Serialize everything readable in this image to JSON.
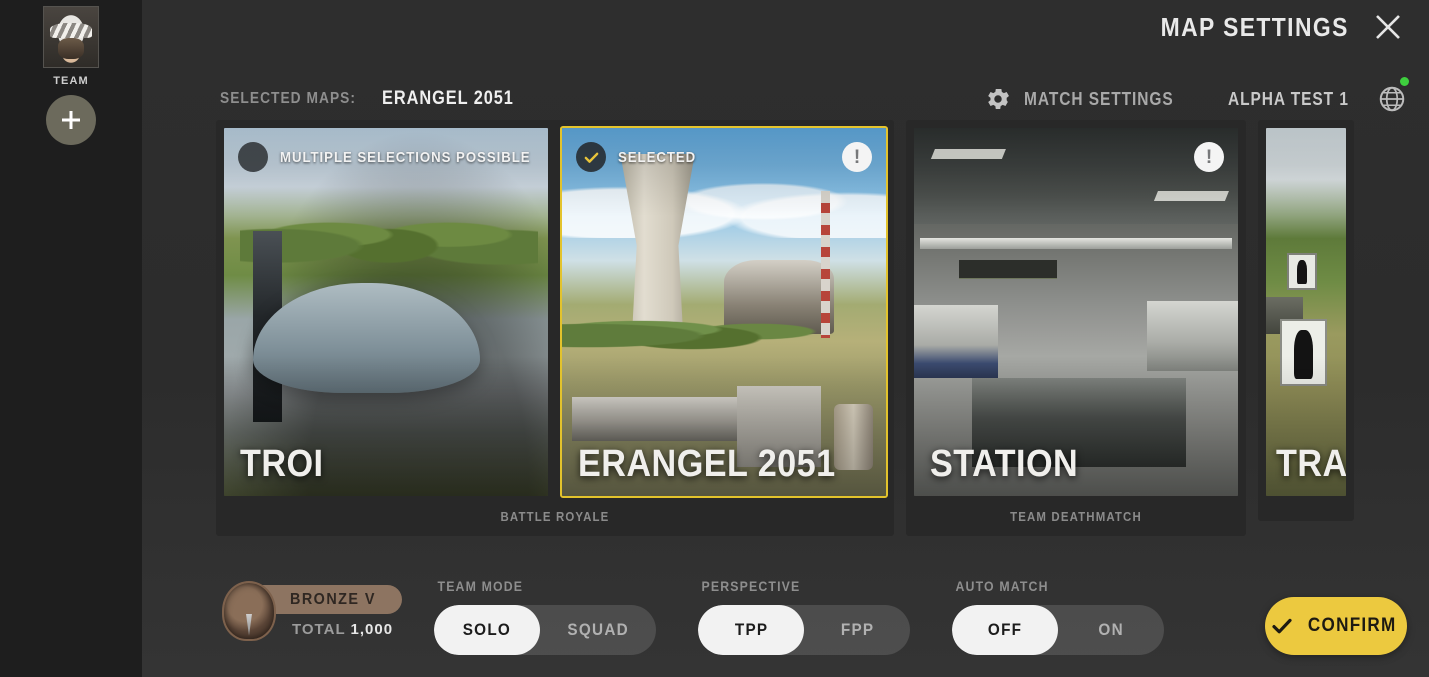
{
  "window": {
    "title": "MAP SETTINGS",
    "close_icon": "close-icon"
  },
  "sidebar": {
    "team_label": "TEAM",
    "avatar_icon": "avatar",
    "add_member_icon": "plus-icon"
  },
  "header": {
    "selected_maps_label": "SELECTED MAPS:",
    "selected_maps_value": "ERANGEL 2051",
    "match_settings_label": "MATCH SETTINGS",
    "gear_icon": "gear-icon",
    "server_label": "ALPHA TEST 1",
    "globe_icon": "globe-icon",
    "server_status_color": "#3ecf3e"
  },
  "map_groups": [
    {
      "mode_label": "BATTLE ROYALE",
      "cards": [
        {
          "name": "TROI",
          "top_label": "MULTIPLE SELECTIONS POSSIBLE",
          "selected": false,
          "info_icon": "info-icon",
          "check_icon": "empty-circle-icon"
        },
        {
          "name": "ERANGEL 2051",
          "top_label": "SELECTED",
          "selected": true,
          "info_icon": "info-icon",
          "check_icon": "check-icon"
        }
      ]
    },
    {
      "mode_label": "TEAM DEATHMATCH",
      "cards": [
        {
          "name": "STATION",
          "top_label": "",
          "selected": false,
          "info_icon": "info-icon",
          "check_icon": ""
        }
      ]
    },
    {
      "mode_label": "",
      "cards": [
        {
          "name": "TRA",
          "top_label": "",
          "selected": false,
          "info_icon": "",
          "check_icon": ""
        }
      ]
    }
  ],
  "rank": {
    "tier": "BRONZE  V",
    "total_label": "TOTAL",
    "total_value": "1,000",
    "medal_icon": "rank-medal-icon"
  },
  "settings": {
    "team_mode": {
      "caption": "TEAM MODE",
      "options": [
        "SOLO",
        "SQUAD"
      ],
      "selected": "SOLO"
    },
    "perspective": {
      "caption": "PERSPECTIVE",
      "options": [
        "TPP",
        "FPP"
      ],
      "selected": "TPP"
    },
    "auto_match": {
      "caption": "AUTO MATCH",
      "options": [
        "OFF",
        "ON"
      ],
      "selected": "OFF"
    }
  },
  "confirm": {
    "label": "CONFIRM",
    "check_icon": "check-icon",
    "color": "#ecc93f"
  }
}
